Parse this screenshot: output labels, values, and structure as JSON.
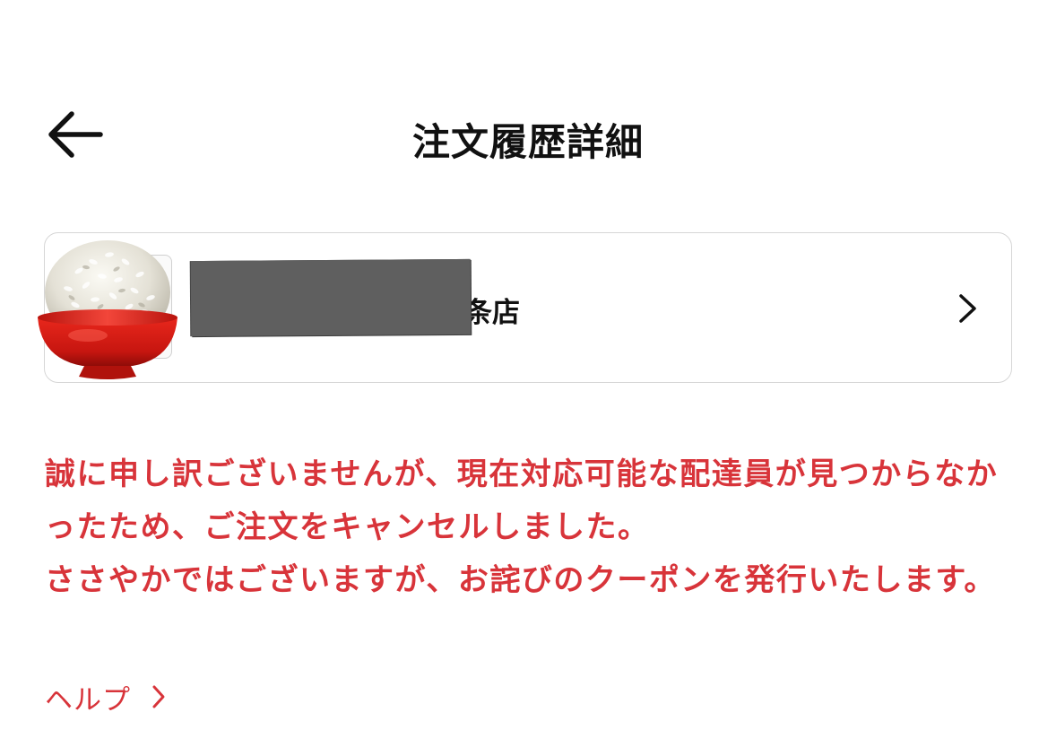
{
  "header": {
    "title": "注文履歴詳細",
    "back_icon": "arrow-left-icon"
  },
  "store_card": {
    "name_visible_fragment": "条店",
    "thumbnail_icon": "rice-bowl-icon",
    "chevron_icon": "chevron-right-icon",
    "border_color": "#d6d6d6"
  },
  "notice": {
    "paragraph_1": "誠に申し訳ございませんが、現在対応可能な配達員が見つからなかったため、ご注文をキャンセルしました。",
    "paragraph_2": "ささやかではございますが、お詫びのクーポンを発行いたします。",
    "color": "#d8343a"
  },
  "help": {
    "label": "ヘルプ",
    "chevron_icon": "chevron-right-icon"
  }
}
